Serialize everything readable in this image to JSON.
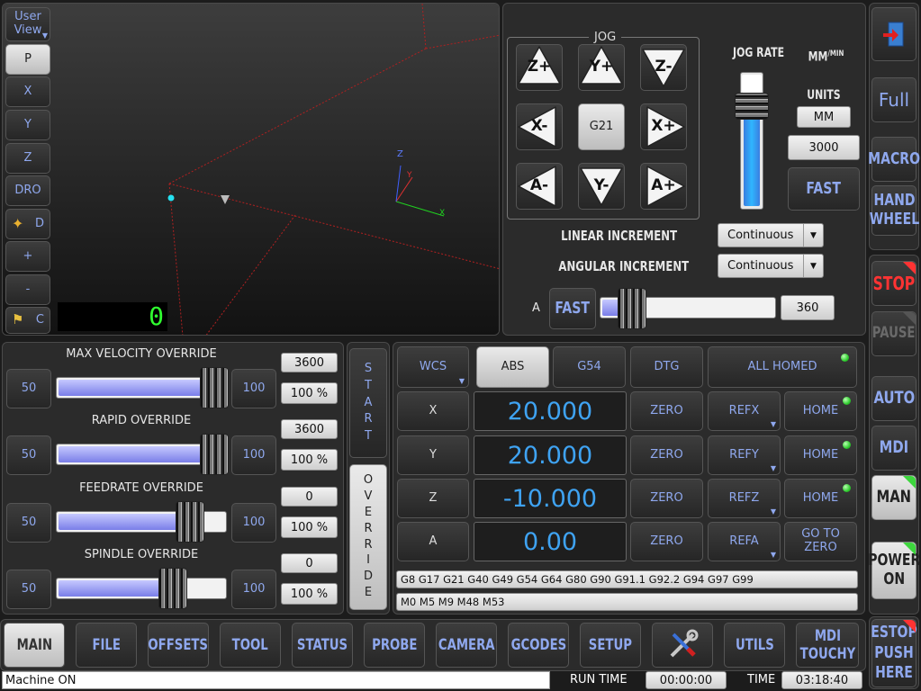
{
  "viewport": {
    "user_view": "User\nView",
    "buttons": [
      "P",
      "X",
      "Y",
      "Z",
      "DRO",
      "D",
      "+",
      "-",
      "C"
    ],
    "counter": "0",
    "axis_labels": {
      "z": "Z",
      "y": "Y",
      "x": "X"
    }
  },
  "jog": {
    "title": "JOG",
    "buttons": [
      "Z+",
      "Y+",
      "Z-",
      "X-",
      "G21",
      "X+",
      "A-",
      "Y-",
      "A+"
    ],
    "jog_rate_label": "JOG RATE",
    "jog_rate_fraction": 0.95,
    "mm_label": "MM",
    "min_label": "MIN",
    "units_label": "UNITS",
    "units_value": "MM",
    "rate_value": "3000",
    "fast_label": "FAST",
    "linear_inc_label": "LINEAR INCREMENT",
    "linear_inc_value": "Continuous",
    "angular_inc_label": "ANGULAR INCREMENT",
    "angular_inc_value": "Continuous",
    "a_label": "A",
    "a_fast_label": "FAST",
    "a_value": "360",
    "a_fraction": 0.1
  },
  "right_column": {
    "top": [
      "Full",
      "MACRO",
      "HAND\nWHEEL"
    ],
    "stop": "STOP",
    "pause": "PAUSE",
    "auto": "AUTO",
    "mdi": "MDI",
    "man": "MAN",
    "power": "POWER\nON",
    "estop": "ESTOP\nPUSH\nHERE"
  },
  "overrides": [
    {
      "title": "MAX VELOCITY OVERRIDE",
      "left": "50",
      "right": "100",
      "value": "3600",
      "percent": "100 %",
      "fraction": 1.0
    },
    {
      "title": "RAPID OVERRIDE",
      "left": "50",
      "right": "100",
      "value": "3600",
      "percent": "100 %",
      "fraction": 1.0
    },
    {
      "title": "FEEDRATE OVERRIDE",
      "left": "50",
      "right": "100",
      "value": "0",
      "percent": "100 %",
      "fraction": 0.83
    },
    {
      "title": "SPINDLE OVERRIDE",
      "left": "50",
      "right": "100",
      "value": "0",
      "percent": "100 %",
      "fraction": 0.71
    }
  ],
  "vertical_buttons": {
    "start": "START",
    "override": "OVERRIDE"
  },
  "dro": {
    "header": {
      "wcs": "WCS",
      "abs": "ABS",
      "g54": "G54",
      "dtg": "DTG",
      "all_homed": "ALL HOMED"
    },
    "axes": [
      {
        "axis": "X",
        "value": "20.000",
        "zero": "ZERO",
        "ref": "REFX",
        "home": "HOME"
      },
      {
        "axis": "Y",
        "value": "20.000",
        "zero": "ZERO",
        "ref": "REFY",
        "home": "HOME"
      },
      {
        "axis": "Z",
        "value": "-10.000",
        "zero": "ZERO",
        "ref": "REFZ",
        "home": "HOME"
      },
      {
        "axis": "A",
        "value": "0.00",
        "zero": "ZERO",
        "ref": "REFA",
        "home": "GO TO\nZERO"
      }
    ],
    "gcodes": "G8 G17 G21 G40 G49 G54 G64 G80 G90 G91.1 G92.2 G94 G97 G99",
    "mcodes": "M0 M5 M9 M48 M53"
  },
  "tabs": [
    "MAIN",
    "FILE",
    "OFFSETS",
    "TOOL",
    "STATUS",
    "PROBE",
    "CAMERA",
    "GCODES",
    "SETUP",
    "",
    "UTILS",
    "MDI\nTOUCHY"
  ],
  "statusbar": {
    "message": "Machine ON",
    "run_time_label": "RUN TIME",
    "run_time": "00:00:00",
    "time_label": "TIME",
    "time": "03:18:40"
  },
  "colors": {
    "accent": "#8fa8ee",
    "dro": "#3fa3f2",
    "led": "#2ecc2e",
    "stop": "#ff3333"
  }
}
